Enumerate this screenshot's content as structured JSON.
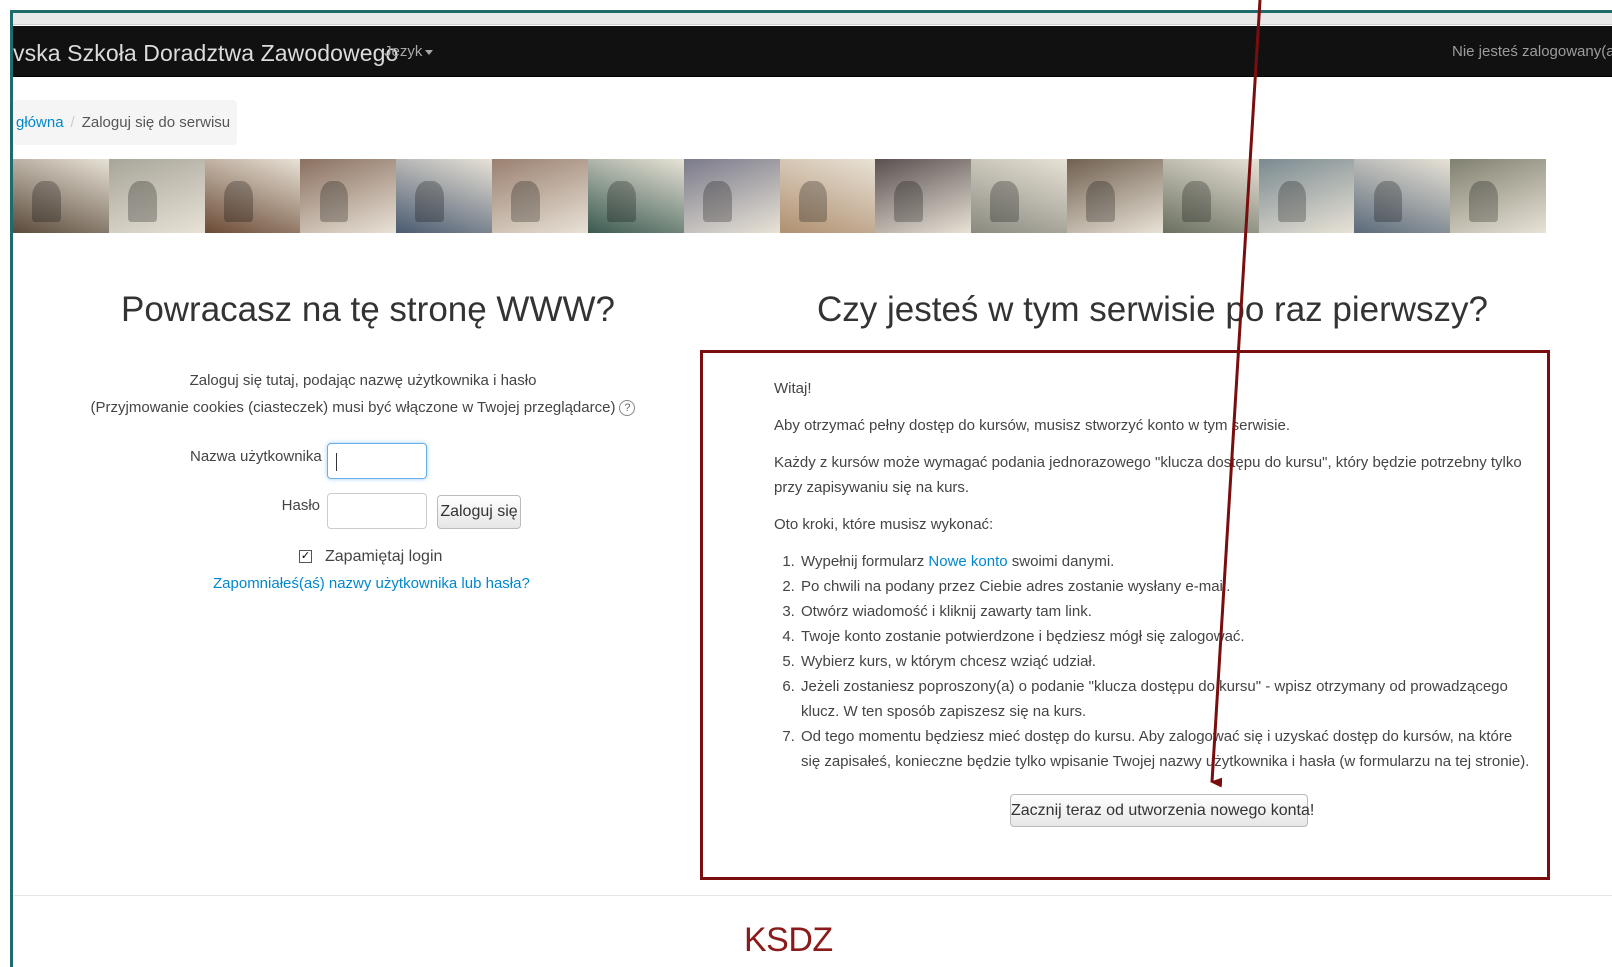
{
  "navbar": {
    "brand": "vska Szkoła Doradztwa Zawodowego",
    "language_menu": "Język",
    "login_status": "Nie jesteś zalogowany(a)"
  },
  "breadcrumb": {
    "home": "główna",
    "current": "Zaloguj się do serwisu"
  },
  "banner": {
    "tile_colors": [
      "#5a4a3a",
      "#a8a59a",
      "#6b4a35",
      "#8a7060",
      "#4a5a70",
      "#9a8070",
      "#3a5a50",
      "#7a7a8a",
      "#b09070",
      "#5a5050",
      "#8a8a80",
      "#706050",
      "#6a7060",
      "#7a8a90",
      "#5a6a7a",
      "#808070"
    ]
  },
  "login": {
    "heading": "Powracasz na tę stronę WWW?",
    "intro_line1": "Zaloguj się tutaj, podając nazwę użytkownika i hasło",
    "intro_line2": "(Przyjmowanie cookies (ciasteczek) musi być włączone w Twojej przeglądarce)",
    "help_glyph": "?",
    "username_label": "Nazwa użytkownika",
    "username_value": "",
    "password_label": "Hasło",
    "password_value": "",
    "login_button": "Zaloguj się",
    "remember_checked_glyph": "✓",
    "remember_label": "Zapamiętaj login",
    "forgot_link": "Zapomniałeś(aś) nazwy użytkownika lub hasła?"
  },
  "signup": {
    "heading": "Czy jesteś w tym serwisie po raz pierwszy?",
    "greeting": "Witaj!",
    "para1": "Aby otrzymać pełny dostęp do kursów, musisz stworzyć konto w tym serwisie.",
    "para2": "Każdy z kursów może wymagać podania jednorazowego \"klucza dostępu do kursu\", który będzie potrzebny tylko przy zapisywaniu się na kurs.",
    "para3": "Oto kroki, które musisz wykonać:",
    "step1_prefix": "Wypełnij formularz ",
    "step1_link": "Nowe konto",
    "step1_suffix": " swoimi danymi.",
    "step2": "Po chwili na podany przez Ciebie adres zostanie wysłany e-mail.",
    "step3": "Otwórz wiadomość i kliknij zawarty tam link.",
    "step4": "Twoje konto zostanie potwierdzone i będziesz mógł się zalogować.",
    "step5": "Wybierz kurs, w którym chcesz wziąć udział.",
    "step6": "Jeżeli zostaniesz poproszony(a) o podanie \"klucza dostępu do kursu\" - wpisz otrzymany od prowadzącego klucz. W ten sposób zapiszesz się na kurs.",
    "step7": "Od tego momentu będziesz mieć dostęp do kursu. Aby zalogować się i uzyskać dostęp do kursów, na które się zapisałeś, konieczne będzie tylko wpisanie Twojej nazwy użytkownika i hasła (w formularzu na tej stronie).",
    "create_button": "Zacznij teraz od utworzenia nowego konta!"
  },
  "footer": {
    "logo": "KSDZ"
  },
  "colors": {
    "annotation": "#7a0e0e",
    "link": "#0088cc",
    "navbar": "#111111"
  }
}
